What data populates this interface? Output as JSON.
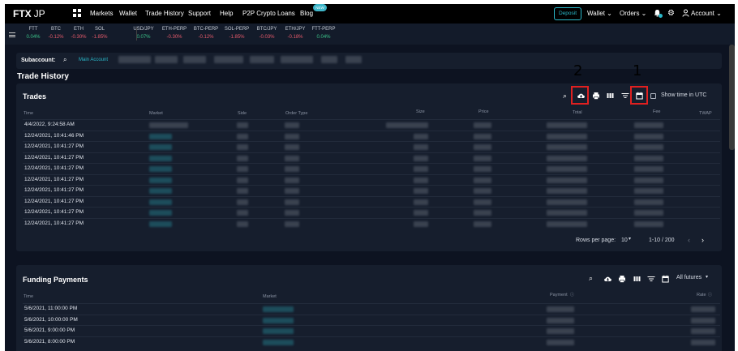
{
  "nav": {
    "logo": "FTX",
    "logo_region": "JP",
    "links": [
      "Markets",
      "Wallet",
      "Trade History",
      "Support",
      "Help",
      "P2P Crypto Loans",
      "Blog"
    ],
    "new_badge": "NEW",
    "deposit": "Deposit",
    "wallet": "Wallet ⌄",
    "orders": "Orders ⌄",
    "account": "Account ⌄"
  },
  "ticker": [
    {
      "symbol": "FTT",
      "change": "0.04%",
      "dir": "up"
    },
    {
      "symbol": "BTC",
      "change": "-0.12%",
      "dir": "down"
    },
    {
      "symbol": "ETH",
      "change": "-0.30%",
      "dir": "down"
    },
    {
      "symbol": "SOL",
      "change": "-1.85%",
      "dir": "down"
    },
    {
      "symbol": "USD/JPY",
      "change": "0.07%",
      "dir": "up"
    },
    {
      "symbol": "ETH-PERP",
      "change": "-0.30%",
      "dir": "down"
    },
    {
      "symbol": "BTC-PERP",
      "change": "-0.12%",
      "dir": "down"
    },
    {
      "symbol": "SOL-PERP",
      "change": "-1.85%",
      "dir": "down"
    },
    {
      "symbol": "BTC/JPY",
      "change": "-0.03%",
      "dir": "down"
    },
    {
      "symbol": "ETH/JPY",
      "change": "-0.18%",
      "dir": "down"
    },
    {
      "symbol": "FTT-PERP",
      "change": "0.04%",
      "dir": "up"
    }
  ],
  "subaccount": {
    "label": "Subaccount:",
    "main": "Main Account"
  },
  "page_title": "Trade History",
  "trades": {
    "title": "Trades",
    "show_utc": "Show time in UTC",
    "columns": [
      "Time",
      "Market",
      "Side",
      "Order Type",
      "Size",
      "Price",
      "Total",
      "Fee",
      "TWAP"
    ],
    "rows": [
      "4/4/2022, 9:24:58 AM",
      "12/24/2021, 10:41:46 PM",
      "12/24/2021, 10:41:27 PM",
      "12/24/2021, 10:41:27 PM",
      "12/24/2021, 10:41:27 PM",
      "12/24/2021, 10:41:27 PM",
      "12/24/2021, 10:41:27 PM",
      "12/24/2021, 10:41:27 PM",
      "12/24/2021, 10:41:27 PM",
      "12/24/2021, 10:41:27 PM"
    ],
    "rows_per_page_label": "Rows per page:",
    "rows_per_page": "10",
    "pagination": "1-10 / 200"
  },
  "annotations": {
    "one": "1",
    "two": "2"
  },
  "funding": {
    "title": "Funding Payments",
    "futures_select": "All futures",
    "columns": [
      "Time",
      "Market",
      "Payment",
      "Rate"
    ],
    "rows": [
      "5/6/2021, 11:00:00 PM",
      "5/6/2021, 10:00:00 PM",
      "5/6/2021, 9:00:00 PM",
      "5/6/2021, 8:00:00 PM"
    ]
  },
  "colors": {
    "accent": "#2ab8c9",
    "up": "#3bc48a",
    "down": "#e85b6c",
    "annotation": "#e02020"
  }
}
